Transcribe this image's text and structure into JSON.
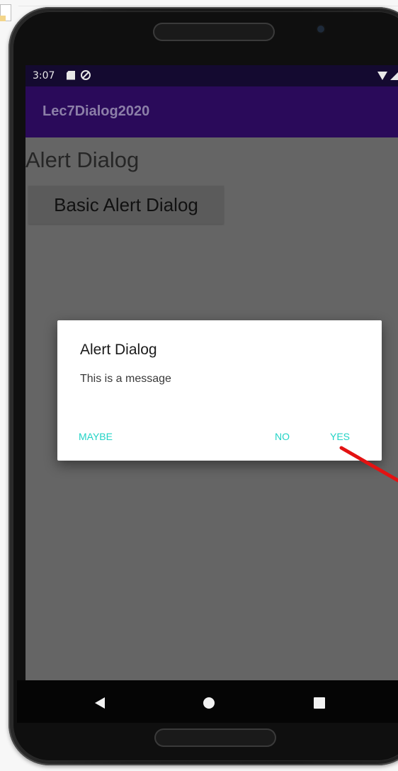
{
  "status_bar": {
    "time": "3:07",
    "left_icons": [
      "sd-card-icon",
      "sync-icon"
    ],
    "right_icons": [
      "wifi-icon",
      "signal-icon",
      "battery-icon"
    ]
  },
  "app_bar": {
    "title": "Lec7Dialog2020"
  },
  "content": {
    "heading": "Alert Dialog",
    "basic_button_label": "Basic Alert Dialog"
  },
  "dialog": {
    "title": "Alert Dialog",
    "message": "This is a message",
    "buttons": {
      "maybe": "MAYBE",
      "no": "NO",
      "yes": "YES"
    },
    "button_color": "#22d3c6"
  },
  "navigation": {
    "icons": [
      "back-icon",
      "home-icon",
      "recents-icon"
    ]
  },
  "colors": {
    "status_bar": "#140a30",
    "app_bar": "#2a0a5a",
    "scrim": "#656565",
    "annotation_arrow": "#e31212"
  }
}
